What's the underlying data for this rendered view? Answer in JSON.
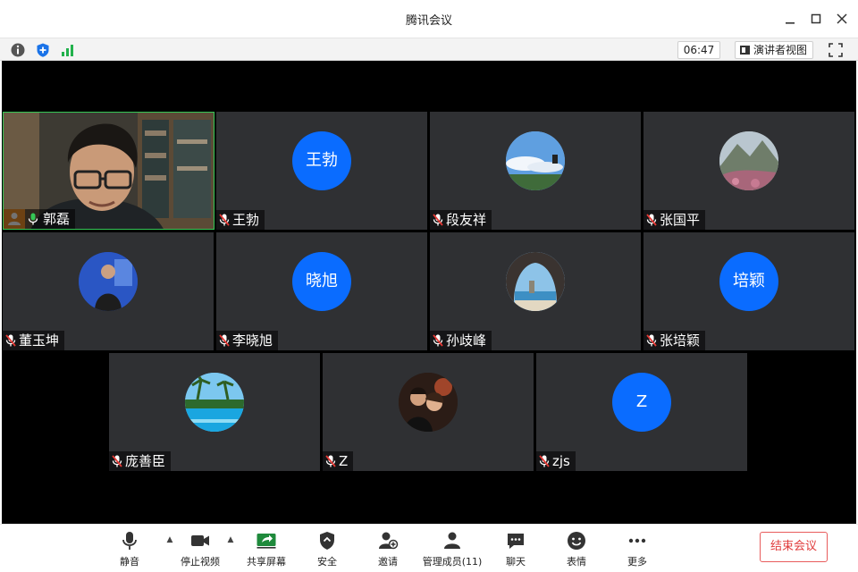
{
  "window": {
    "title": "腾讯会议"
  },
  "statusbar": {
    "timer": "06:47",
    "speaker_view_label": "演讲者视图"
  },
  "participants": [
    {
      "name": "郭磊",
      "avatar_text": "",
      "avatar_kind": "video",
      "host": true,
      "muted": false
    },
    {
      "name": "王勃",
      "avatar_text": "王勃",
      "avatar_kind": "text",
      "muted": true
    },
    {
      "name": "段友祥",
      "avatar_text": "",
      "avatar_kind": "photo-sky",
      "muted": true
    },
    {
      "name": "张国平",
      "avatar_text": "",
      "avatar_kind": "photo-mountain",
      "muted": true
    },
    {
      "name": "董玉坤",
      "avatar_text": "",
      "avatar_kind": "photo-person",
      "muted": true
    },
    {
      "name": "李晓旭",
      "avatar_text": "晓旭",
      "avatar_kind": "text",
      "muted": true
    },
    {
      "name": "孙歧峰",
      "avatar_text": "",
      "avatar_kind": "photo-cave",
      "muted": true
    },
    {
      "name": "张培颖",
      "avatar_text": "培颖",
      "avatar_kind": "text",
      "muted": true
    },
    {
      "name": "庞善臣",
      "avatar_text": "",
      "avatar_kind": "photo-pool",
      "muted": true
    },
    {
      "name": "Z",
      "avatar_text": "",
      "avatar_kind": "photo-couple",
      "muted": true
    },
    {
      "name": "zjs",
      "avatar_text": "Z",
      "avatar_kind": "text",
      "muted": true
    }
  ],
  "toolbar": {
    "mute": "静音",
    "stop_video": "停止视频",
    "share_screen": "共享屏幕",
    "security": "安全",
    "invite": "邀请",
    "manage_members": "管理成员(11)",
    "chat": "聊天",
    "reactions": "表情",
    "more": "更多",
    "end_meeting": "结束会议"
  },
  "colors": {
    "accent": "#0a6cff",
    "host_badge": "#f0902a",
    "active_border": "#35c755",
    "end_button": "#e03c3c",
    "tile_bg": "#2f3033"
  }
}
